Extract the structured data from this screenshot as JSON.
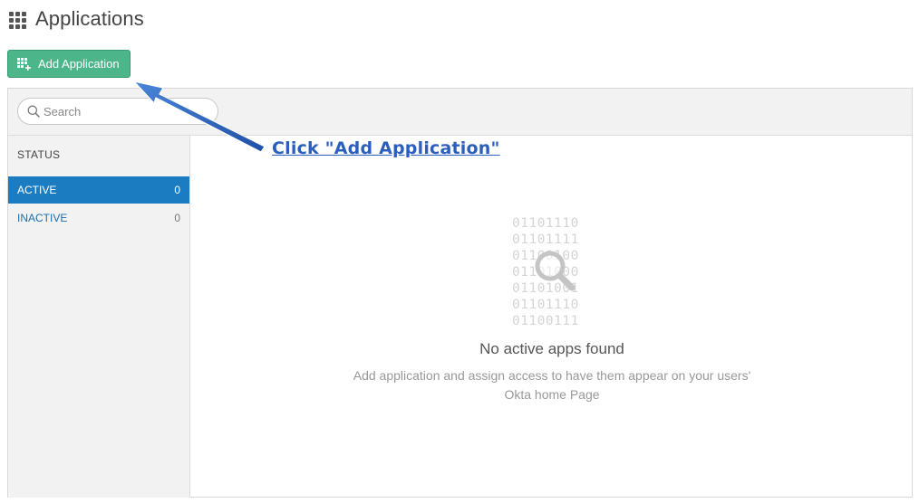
{
  "header": {
    "title": "Applications",
    "icon": "apps-grid-icon"
  },
  "toolbar": {
    "add_label": "Add Application"
  },
  "search": {
    "placeholder": "Search",
    "value": ""
  },
  "sidebar": {
    "heading": "STATUS",
    "items": [
      {
        "label": "ACTIVE",
        "count": "0",
        "selected": true
      },
      {
        "label": "INACTIVE",
        "count": "0",
        "selected": false
      }
    ]
  },
  "empty_state": {
    "binary_lines": [
      "01101110",
      "01101111",
      "01100100",
      "01101000",
      "01101001",
      "01101110",
      "01100111"
    ],
    "title": "No active apps found",
    "description": "Add application and assign access to have them appear on your users' Okta home Page"
  },
  "annotation": {
    "text": "Click \"Add Application\""
  },
  "colors": {
    "primary_button": "#4cb58a",
    "active_item": "#1b7cc2",
    "annotation": "#2b5fbd"
  }
}
